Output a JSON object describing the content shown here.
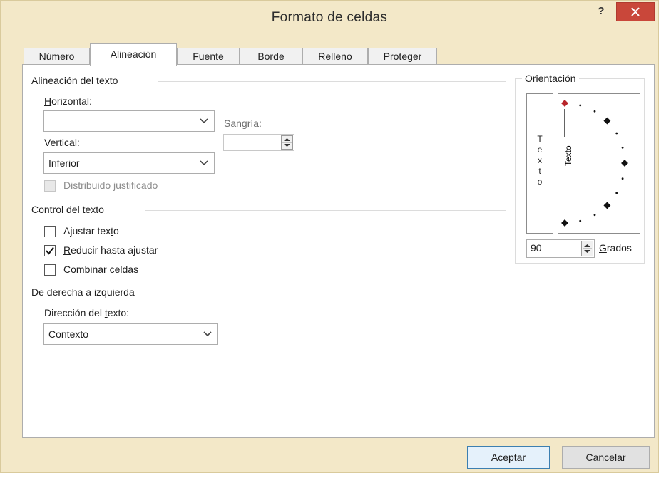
{
  "window": {
    "title": "Formato de celdas",
    "help_label": "?"
  },
  "tabs": [
    {
      "label": "Número"
    },
    {
      "label": "Alineación"
    },
    {
      "label": "Fuente"
    },
    {
      "label": "Borde"
    },
    {
      "label": "Relleno"
    },
    {
      "label": "Proteger"
    }
  ],
  "active_tab": "Alineación",
  "text_alignment": {
    "title": "Alineación del texto",
    "horizontal_label_key": "H",
    "horizontal_label_rest": "orizontal:",
    "horizontal_value": "",
    "vertical_label_key": "V",
    "vertical_label_rest": "ertical:",
    "vertical_value": "Inferior",
    "indent_label": "Sangría:",
    "indent_value": "",
    "justify_distributed_label": "Distribuido justificado",
    "justify_distributed_checked": false
  },
  "text_control": {
    "title": "Control del texto",
    "wrap_label_pre": "Ajustar tex",
    "wrap_label_key": "t",
    "wrap_label_post": "o",
    "wrap_checked": false,
    "shrink_label_key": "R",
    "shrink_label_rest": "educir hasta ajustar",
    "shrink_checked": true,
    "merge_label_key": "C",
    "merge_label_rest": "ombinar celdas",
    "merge_checked": false
  },
  "rtl": {
    "title": "De derecha a izquierda",
    "direction_label_pre": "Dirección del ",
    "direction_label_key": "t",
    "direction_label_post": "exto:",
    "direction_value": "Contexto"
  },
  "orientation": {
    "title": "Orientación",
    "vertical_text_chars": [
      "T",
      "e",
      "x",
      "t",
      "o"
    ],
    "rotated_text": "Texto",
    "degrees_value": "90",
    "degrees_label_key": "G",
    "degrees_label_rest": "rados",
    "degrees": 90,
    "marker_color": "#b8252a"
  },
  "buttons": {
    "accept": "Aceptar",
    "cancel": "Cancelar"
  },
  "colors": {
    "frame": "#f3e8c8",
    "close": "#c9473a",
    "default_button_border": "#3c7fb1"
  }
}
